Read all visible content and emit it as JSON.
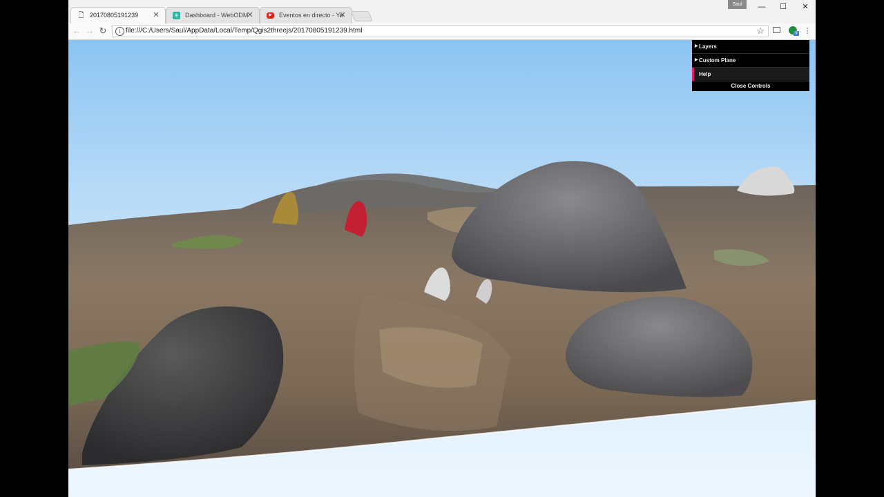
{
  "tabs": [
    {
      "label": "20170805191239",
      "icon": "page-icon",
      "active": true
    },
    {
      "label": "Dashboard - WebODM",
      "icon": "webodm-icon",
      "active": false
    },
    {
      "label": "Eventos en directo - YouTube",
      "icon": "youtube-icon",
      "active": false
    }
  ],
  "window": {
    "profile_label": "Saul"
  },
  "toolbar": {
    "url": "file:///C:/Users/Saul/AppData/Local/Temp/Qgis2threejs/20170805191239.html"
  },
  "controls": {
    "folders": [
      {
        "label": "Layers"
      },
      {
        "label": "Custom Plane"
      }
    ],
    "help_label": "Help",
    "close_label": "Close Controls"
  },
  "colors": {
    "sky_top": "#8cc4f2",
    "ground": "#7a6a58",
    "gui_bg": "#1a1a1a",
    "help_accent": "#e61d5f"
  }
}
